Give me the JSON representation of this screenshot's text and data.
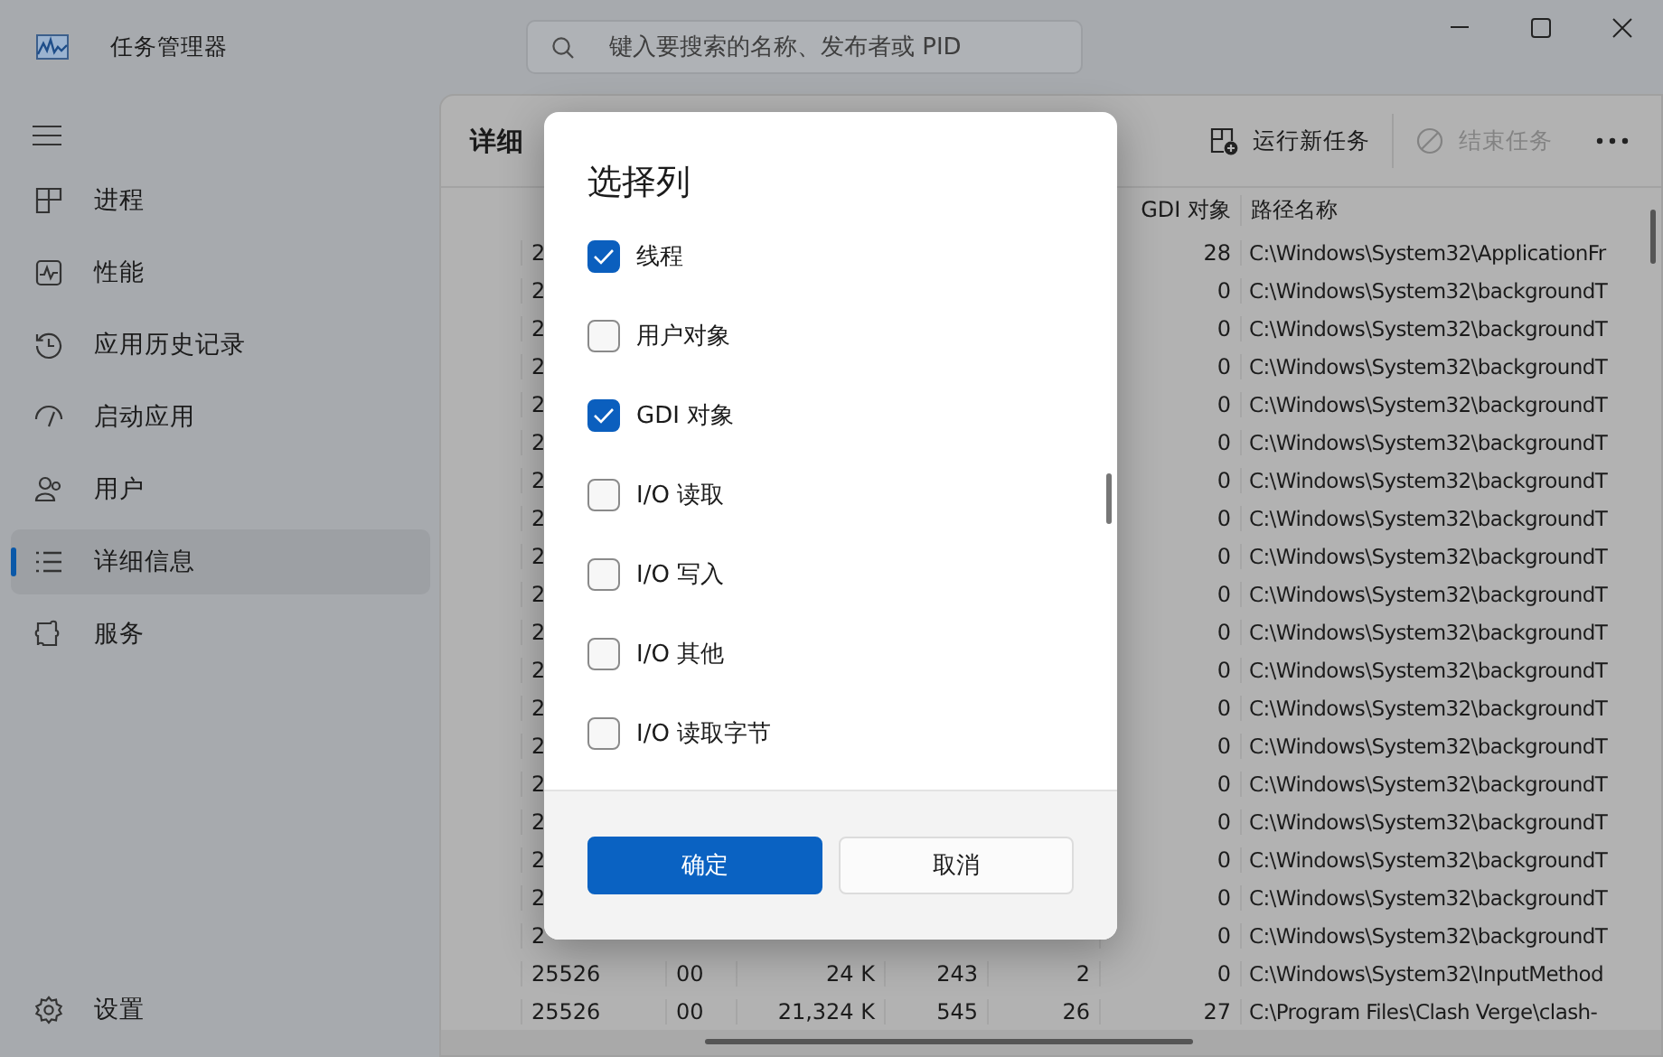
{
  "window": {
    "title": "任务管理器"
  },
  "search": {
    "placeholder": "键入要搜索的名称、发布者或 PID"
  },
  "sidebar": {
    "items": [
      {
        "label": "进程",
        "selected": false
      },
      {
        "label": "性能",
        "selected": false
      },
      {
        "label": "应用历史记录",
        "selected": false
      },
      {
        "label": "启动应用",
        "selected": false
      },
      {
        "label": "用户",
        "selected": false
      },
      {
        "label": "详细信息",
        "selected": true
      },
      {
        "label": "服务",
        "selected": false
      }
    ],
    "footer": {
      "label": "设置"
    }
  },
  "page": {
    "title": "详细",
    "toolbar": [
      {
        "label": "运行新任务",
        "disabled": false
      },
      {
        "label": "结束任务",
        "disabled": true
      }
    ]
  },
  "table": {
    "columns": [
      "GDI 对象",
      "路径名称"
    ],
    "rows": [
      {
        "column_1": "2",
        "gdi": "28",
        "path": "C:\\Windows\\System32\\ApplicationFr"
      },
      {
        "column_1": "2",
        "gdi": "0",
        "path": "C:\\Windows\\System32\\backgroundT"
      },
      {
        "column_1": "2",
        "gdi": "0",
        "path": "C:\\Windows\\System32\\backgroundT"
      },
      {
        "column_1": "2",
        "gdi": "0",
        "path": "C:\\Windows\\System32\\backgroundT"
      },
      {
        "column_1": "2",
        "gdi": "0",
        "path": "C:\\Windows\\System32\\backgroundT"
      },
      {
        "column_1": "2",
        "gdi": "0",
        "path": "C:\\Windows\\System32\\backgroundT"
      },
      {
        "column_1": "2",
        "gdi": "0",
        "path": "C:\\Windows\\System32\\backgroundT"
      },
      {
        "column_1": "2",
        "gdi": "0",
        "path": "C:\\Windows\\System32\\backgroundT"
      },
      {
        "column_1": "2",
        "gdi": "0",
        "path": "C:\\Windows\\System32\\backgroundT"
      },
      {
        "column_1": "2",
        "gdi": "0",
        "path": "C:\\Windows\\System32\\backgroundT"
      },
      {
        "column_1": "2",
        "gdi": "0",
        "path": "C:\\Windows\\System32\\backgroundT"
      },
      {
        "column_1": "2",
        "gdi": "0",
        "path": "C:\\Windows\\System32\\backgroundT"
      },
      {
        "column_1": "2",
        "gdi": "0",
        "path": "C:\\Windows\\System32\\backgroundT"
      },
      {
        "column_1": "2",
        "gdi": "0",
        "path": "C:\\Windows\\System32\\backgroundT"
      },
      {
        "column_1": "2",
        "gdi": "0",
        "path": "C:\\Windows\\System32\\backgroundT"
      },
      {
        "column_1": "2",
        "gdi": "0",
        "path": "C:\\Windows\\System32\\backgroundT"
      },
      {
        "column_1": "2",
        "gdi": "0",
        "path": "C:\\Windows\\System32\\backgroundT"
      },
      {
        "column_1": "2",
        "gdi": "0",
        "path": "C:\\Windows\\System32\\backgroundT"
      },
      {
        "column_1": "2",
        "gdi": "0",
        "path": "C:\\Windows\\System32\\backgroundT"
      },
      {
        "column_1": "25526",
        "column_2": "00",
        "column_3": "24 K",
        "column_4": "243",
        "column_5": "2",
        "gdi": "0",
        "path": "C:\\Windows\\System32\\InputMethod"
      },
      {
        "column_1": "25526",
        "column_2": "00",
        "column_3": "21,324 K",
        "column_4": "545",
        "column_5": "26",
        "gdi": "27",
        "path": "C:\\Program Files\\Clash Verge\\clash-"
      }
    ]
  },
  "dialog": {
    "title": "选择列",
    "options": [
      {
        "label": "线程",
        "checked": true
      },
      {
        "label": "用户对象",
        "checked": false
      },
      {
        "label": "GDI 对象",
        "checked": true
      },
      {
        "label": "I/O 读取",
        "checked": false
      },
      {
        "label": "I/O 写入",
        "checked": false
      },
      {
        "label": "I/O 其他",
        "checked": false
      },
      {
        "label": "I/O 读取字节",
        "checked": false
      }
    ],
    "buttons": [
      {
        "label": "确定",
        "kind": "primary"
      },
      {
        "label": "取消",
        "kind": "secondary"
      }
    ]
  }
}
